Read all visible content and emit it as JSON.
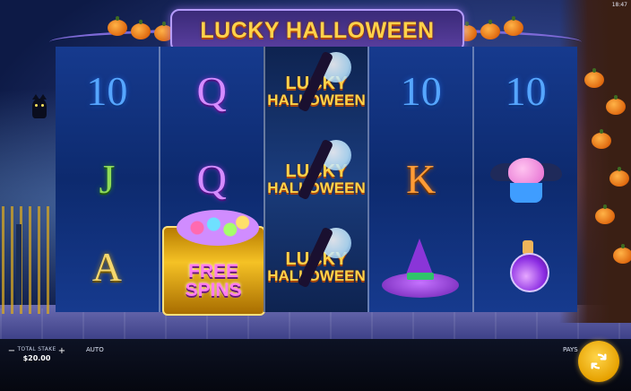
{
  "game": {
    "title": "LUCKY HALLOWEEN",
    "clock": "18:47"
  },
  "reels": [
    [
      "10",
      "J",
      "A"
    ],
    [
      "Q",
      "Q",
      "FREE SPINS"
    ],
    [
      "LUCKY HALLOWEEN",
      "LUCKY HALLOWEEN",
      "LUCKY HALLOWEEN"
    ],
    [
      "10",
      "K",
      "witch-hat"
    ],
    [
      "10",
      "bat-cupcake",
      "potion"
    ]
  ],
  "free_spins": {
    "line1": "FREE",
    "line2": "SPINS"
  },
  "lucky": {
    "line1": "LUCKY",
    "line2": "HALLOWEEN"
  },
  "hud": {
    "stake_label": "TOTAL STAKE",
    "stake_value": "$20.00",
    "minus_label": "−",
    "plus_label": "+",
    "auto_label": "AUTO",
    "pays_label": "PAYS"
  },
  "colors": {
    "gold": "#ffd24a",
    "reel_blue": "#163a8e",
    "purple_frame": "#7e6ad8"
  },
  "icons": {
    "spin": "spin-arrows-icon"
  }
}
